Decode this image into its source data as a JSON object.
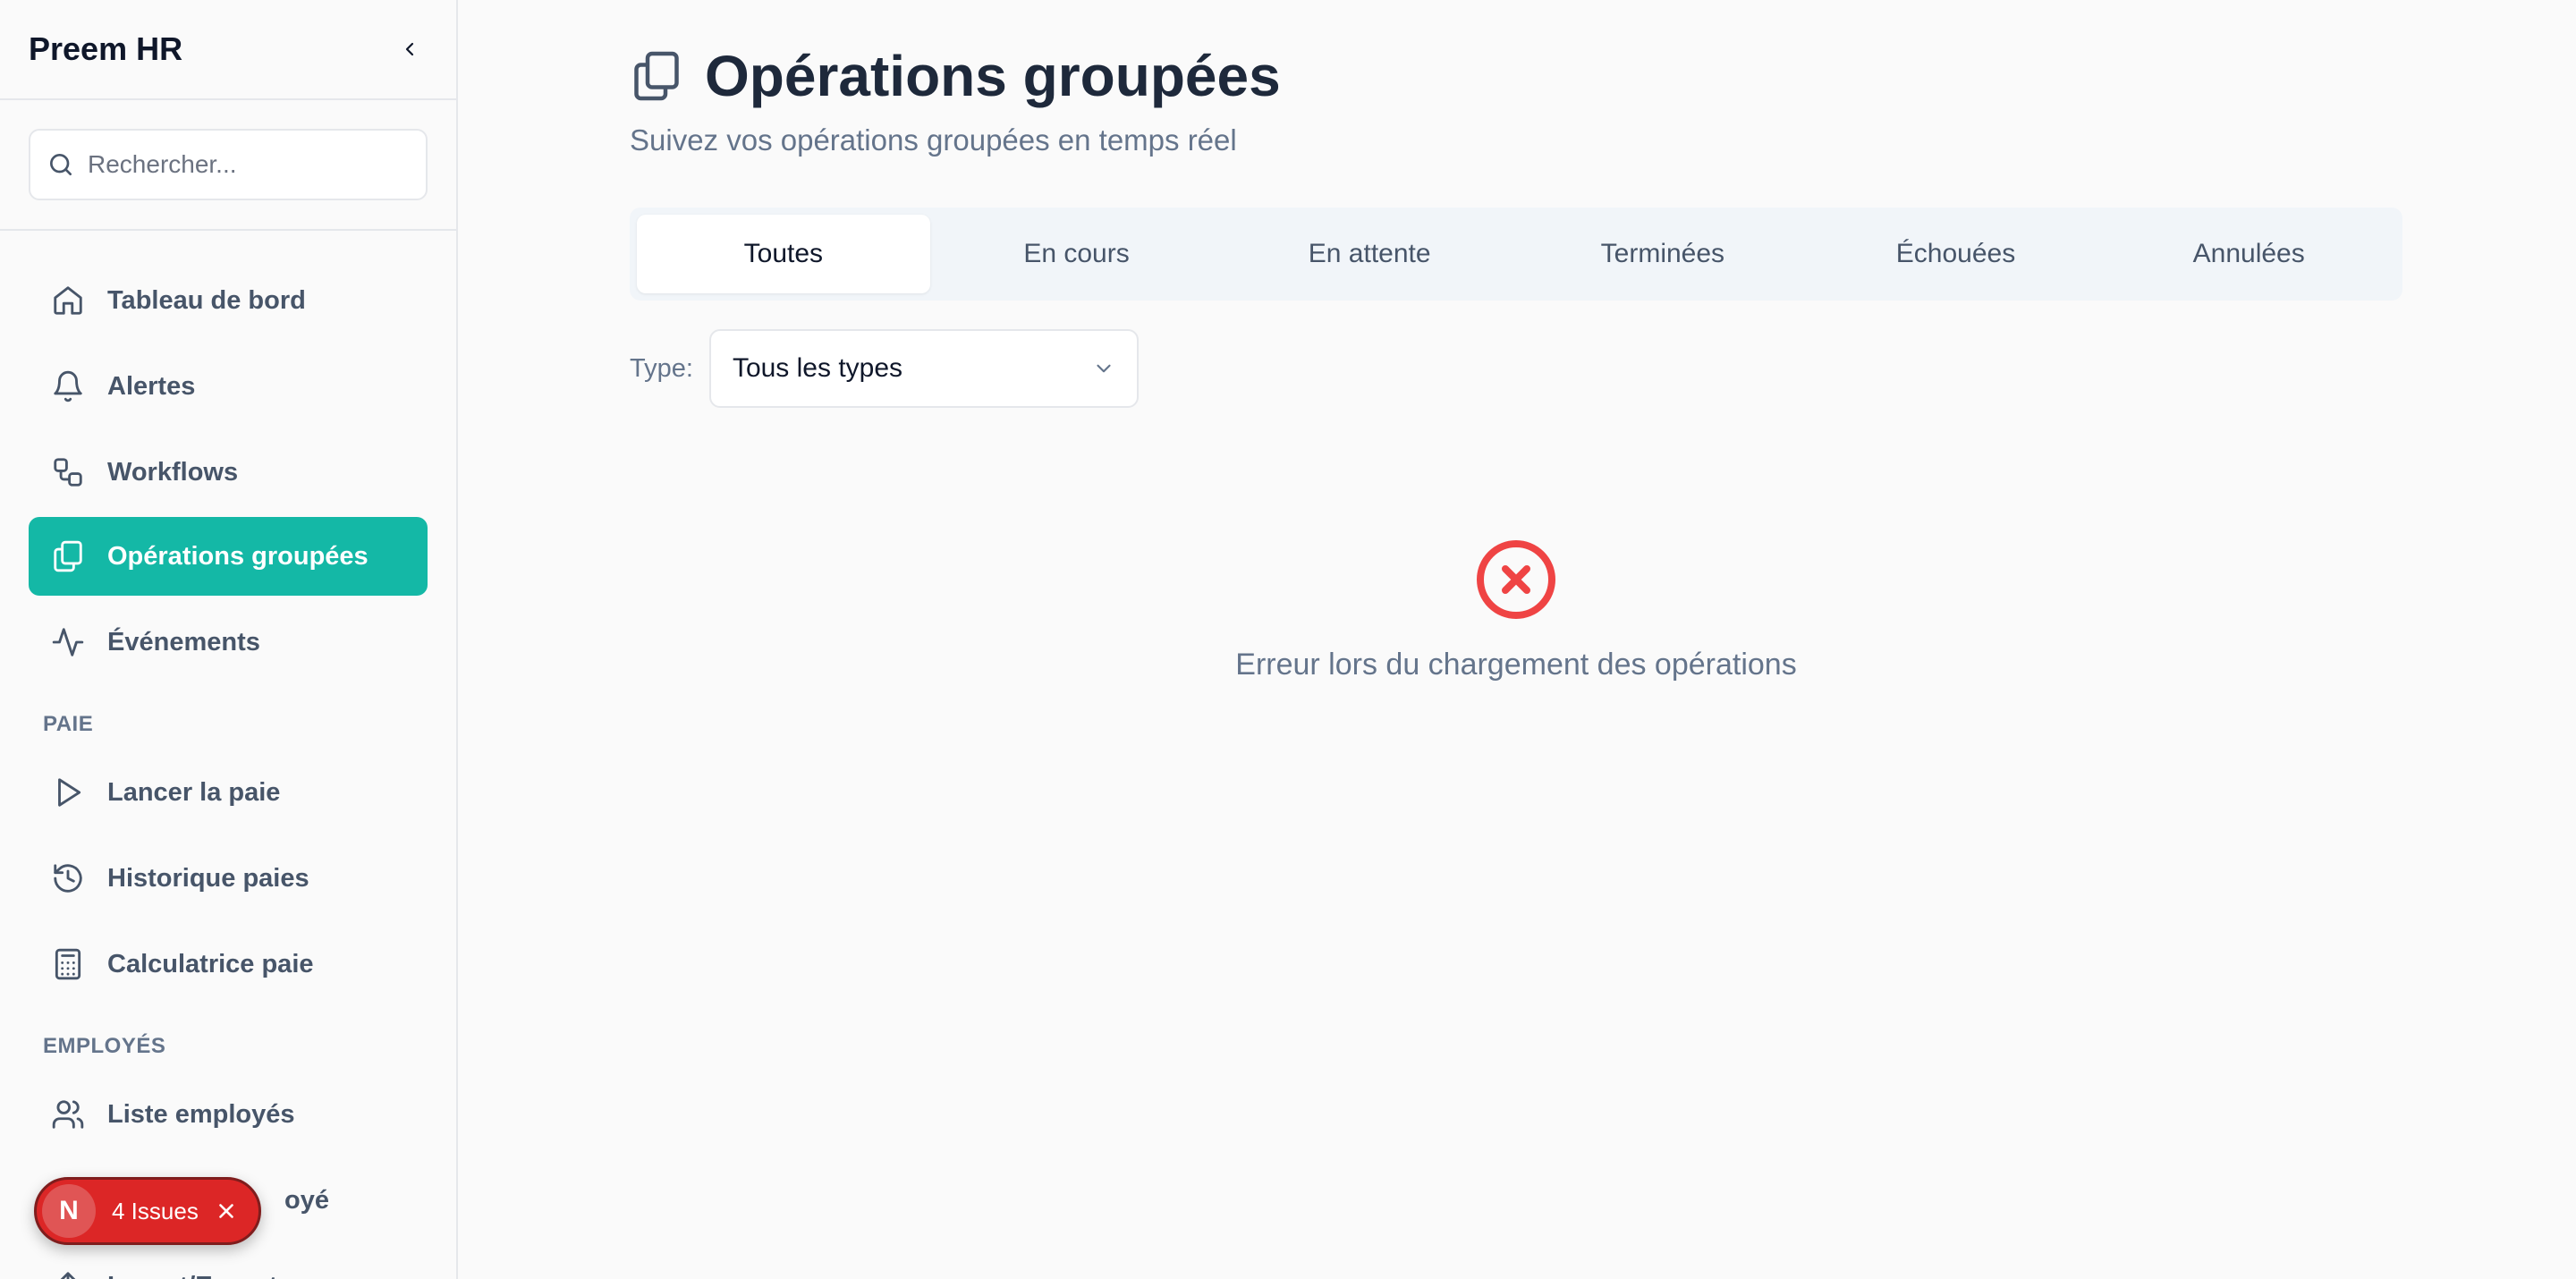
{
  "app": {
    "brand": "Preem HR"
  },
  "sidebar": {
    "search_placeholder": "Rechercher...",
    "items": [
      {
        "label": "Tableau de bord",
        "icon": "home-icon"
      },
      {
        "label": "Alertes",
        "icon": "bell-icon"
      },
      {
        "label": "Workflows",
        "icon": "workflow-icon"
      },
      {
        "label": "Opérations groupées",
        "icon": "copy-icon",
        "active": true
      },
      {
        "label": "Événements",
        "icon": "activity-icon"
      }
    ],
    "sections": [
      {
        "title": "PAIE",
        "items": [
          {
            "label": "Lancer la paie",
            "icon": "play-icon"
          },
          {
            "label": "Historique paies",
            "icon": "history-icon"
          },
          {
            "label": "Calculatrice paie",
            "icon": "calculator-icon"
          }
        ]
      },
      {
        "title": "EMPLOYÉS",
        "items": [
          {
            "label": "Liste employés",
            "icon": "users-icon"
          },
          {
            "label": "oyé",
            "icon": "user-icon"
          },
          {
            "label": "Import/Export",
            "icon": "upload-icon"
          }
        ]
      }
    ]
  },
  "main": {
    "title": "Opérations groupées",
    "subtitle": "Suivez vos opérations groupées en temps réel",
    "tabs": [
      {
        "label": "Toutes",
        "active": true
      },
      {
        "label": "En cours"
      },
      {
        "label": "En attente"
      },
      {
        "label": "Terminées"
      },
      {
        "label": "Échouées"
      },
      {
        "label": "Annulées"
      }
    ],
    "filter": {
      "label": "Type:",
      "value": "Tous les types"
    },
    "error": {
      "message": "Erreur lors du chargement des opérations",
      "color": "#ef4444"
    }
  },
  "issues_toast": {
    "badge": "N",
    "label": "4 Issues"
  },
  "colors": {
    "accent": "#14b8a6",
    "error": "#dc2626"
  }
}
